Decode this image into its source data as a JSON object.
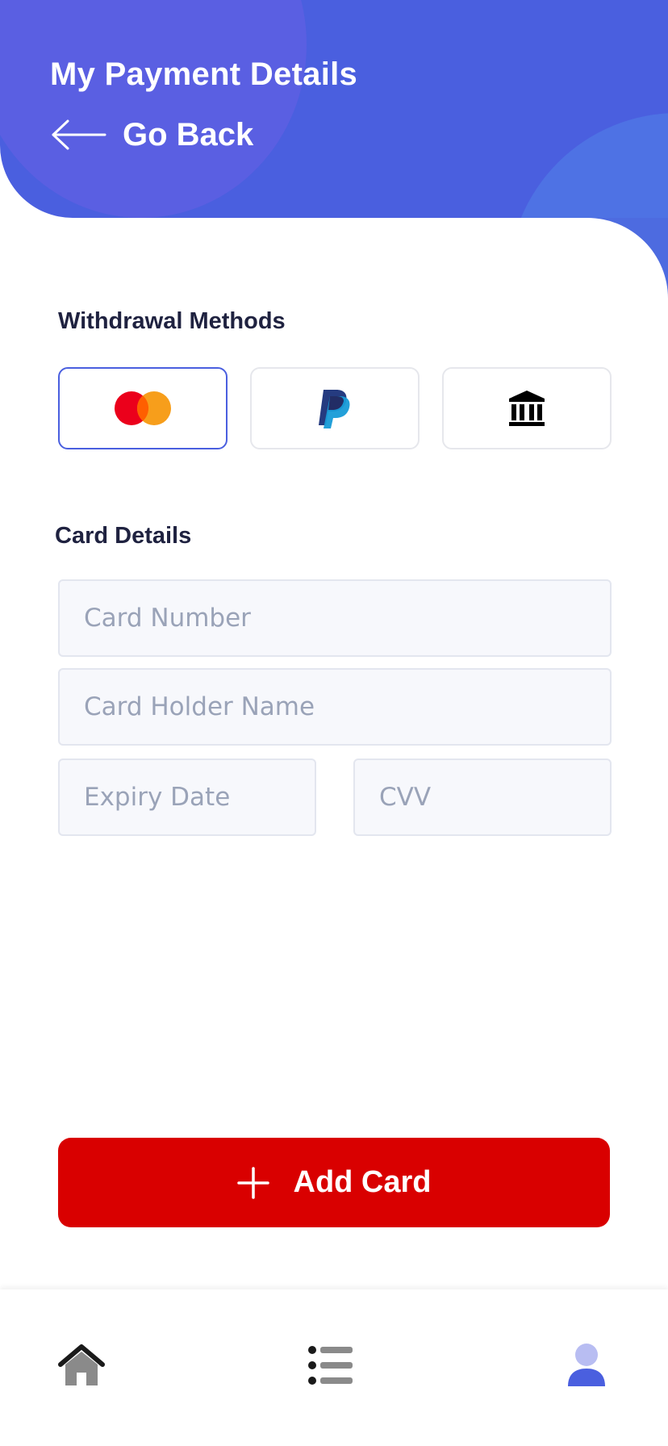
{
  "header": {
    "title": "My Payment Details",
    "back_label": "Go Back",
    "back_icon": "arrow-left-icon",
    "color": "#4a5fdf"
  },
  "withdrawal": {
    "title": "Withdrawal Methods",
    "methods": [
      {
        "name": "Mastercard",
        "icon": "mastercard-icon",
        "selected": true
      },
      {
        "name": "PayPal",
        "icon": "paypal-icon",
        "selected": false
      },
      {
        "name": "Bank",
        "icon": "bank-icon",
        "selected": false
      }
    ],
    "selected_border_color": "#4a5fdf"
  },
  "card_details": {
    "title": "Card Details",
    "card_number": {
      "placeholder": "Card Number",
      "value": ""
    },
    "card_holder": {
      "placeholder": "Card Holder Name",
      "value": ""
    },
    "expiry": {
      "placeholder": "Expiry Date",
      "value": ""
    },
    "cvv": {
      "placeholder": "CVV",
      "value": ""
    }
  },
  "add_card": {
    "label": "Add Card",
    "icon": "plus-icon",
    "color": "#d90000"
  },
  "bottom_nav": {
    "items": [
      {
        "icon": "home-icon",
        "active": false
      },
      {
        "icon": "list-icon",
        "active": false
      },
      {
        "icon": "profile-icon",
        "active": true
      }
    ],
    "active_color": "#4a5fdf"
  }
}
